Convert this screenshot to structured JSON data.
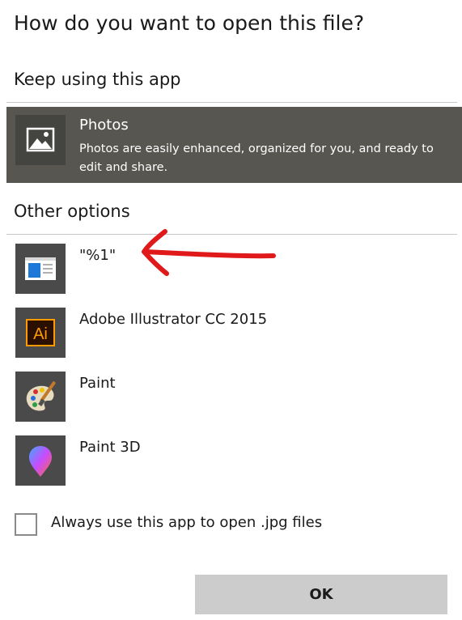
{
  "dialog": {
    "title": "How do you want to open this file?",
    "keep_heading": "Keep using this app",
    "other_heading": "Other options",
    "checkbox_label": "Always use this app to open .jpg files",
    "checkbox_checked": false,
    "ok_label": "OK"
  },
  "selected_app": {
    "name": "Photos",
    "description": "Photos are easily enhanced, organized for you, and ready to edit and share.",
    "icon": "photos-icon"
  },
  "other_apps": [
    {
      "name": "\"%1\"",
      "icon": "generic-app-icon"
    },
    {
      "name": "Adobe Illustrator CC 2015",
      "icon": "illustrator-icon",
      "icon_text": "Ai"
    },
    {
      "name": "Paint",
      "icon": "paint-palette-icon"
    },
    {
      "name": "Paint 3D",
      "icon": "paint-3d-icon"
    }
  ],
  "colors": {
    "selected_bg": "#575650",
    "button_bg": "#cccccc",
    "annotation": "#e0191b",
    "illustrator_orange": "#ff9a00"
  }
}
